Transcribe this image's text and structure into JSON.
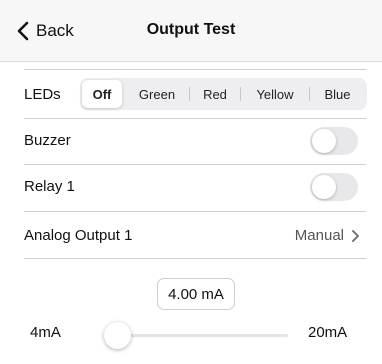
{
  "navbar": {
    "back_label": "Back",
    "title": "Output Test"
  },
  "leds": {
    "label": "LEDs",
    "options": [
      "Off",
      "Green",
      "Red",
      "Yellow",
      "Blue"
    ],
    "selected": "Off"
  },
  "buzzer": {
    "label": "Buzzer",
    "on": false
  },
  "relay1": {
    "label": "Relay 1",
    "on": false
  },
  "analog_output_1": {
    "label": "Analog Output 1",
    "mode": "Manual"
  },
  "slider": {
    "value_text": "4.00 mA",
    "min_label": "4mA",
    "max_label": "20mA",
    "value": 4.0,
    "min": 4,
    "max": 20
  },
  "colors": {
    "accent": "#4a7bd8",
    "toggle_off": "#e8e8ea",
    "navbar_bg": "#f7f7f7"
  }
}
